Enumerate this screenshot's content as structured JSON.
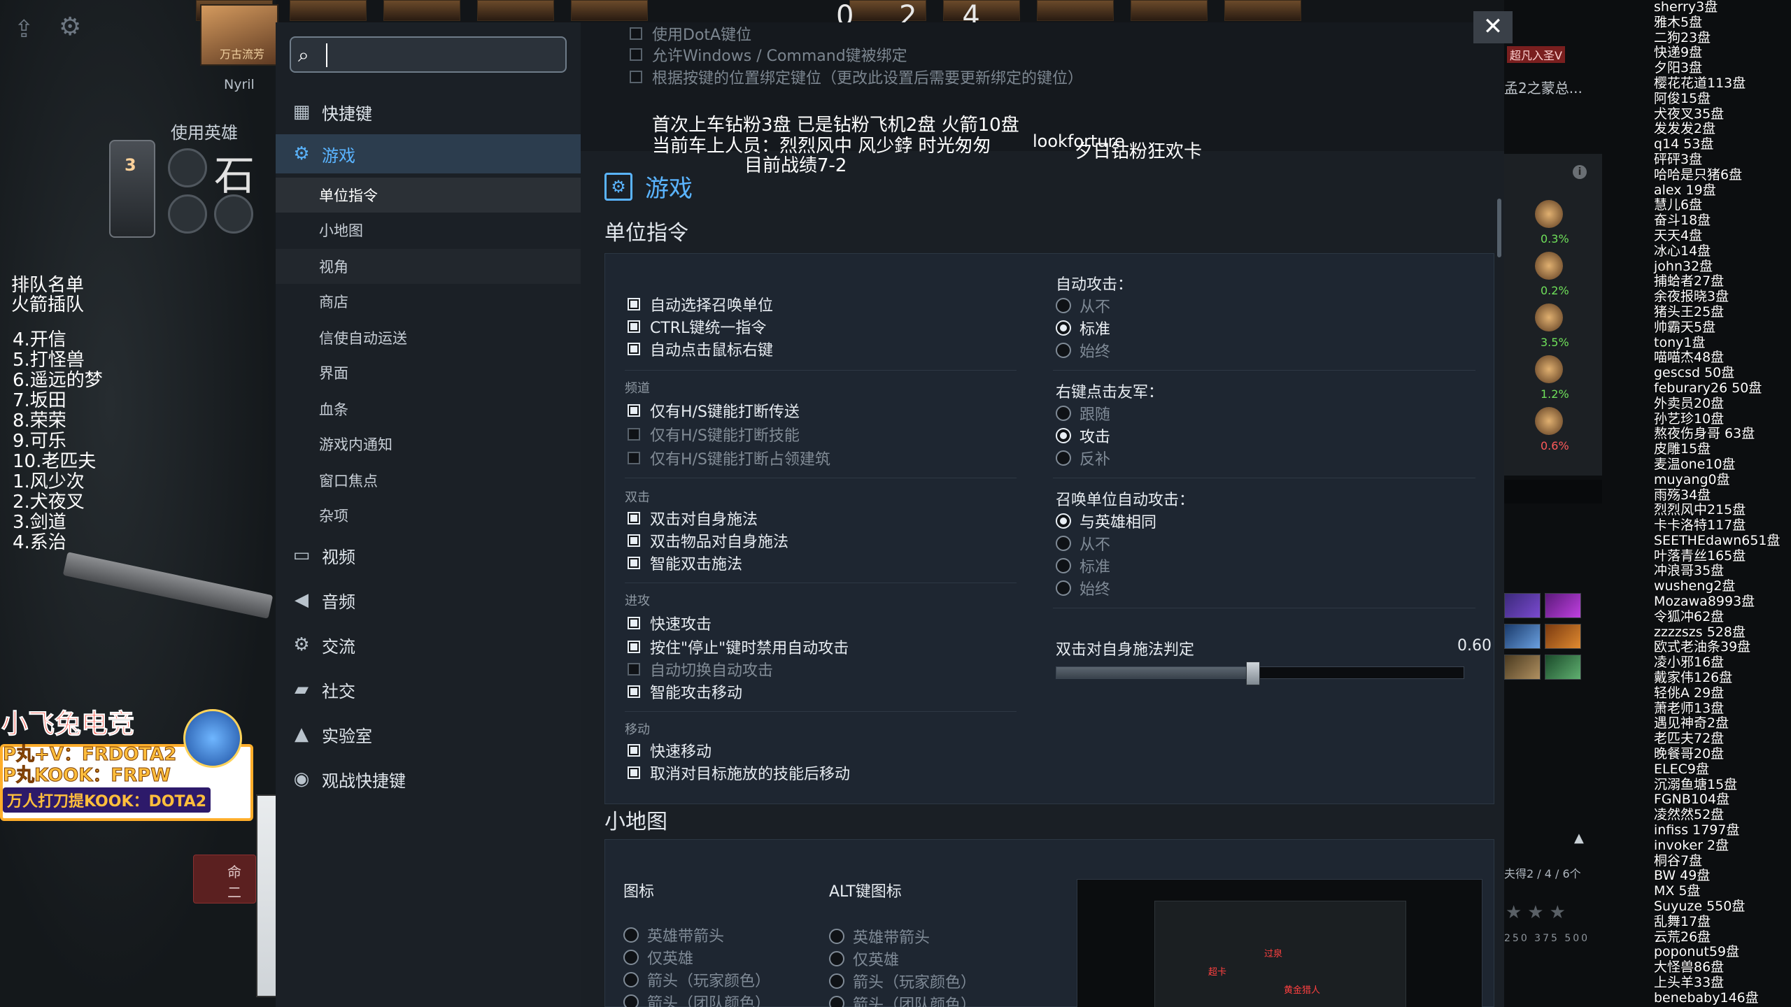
{
  "background": {
    "score_top": "0 2 4",
    "hero_portrait_label": "万古流芳",
    "nyril": "Nyril",
    "use_hero": "使用英雄",
    "rank_num": "3",
    "hero_name_big": "石",
    "queue_title": "排队名单\n火箭插队",
    "queue_list": [
      "4.开信",
      "5.打怪兽",
      "6.遥远的梦",
      "7.坂田",
      "8.荣荣",
      "9.可乐",
      "10.老匹夫",
      "1.风少次",
      "2.犬夜叉",
      "3.剑道",
      "4.系治"
    ],
    "promo": {
      "title": "小飞兔电竞",
      "line1": "P丸+V：FRDOTA2",
      "line2": "P丸KOOK：FRPW",
      "line3": "万人打刀提KOOK：DOTA2"
    },
    "left_tag": "命 二"
  },
  "nav": {
    "search_placeholder": "",
    "items": [
      {
        "label": "快捷键",
        "icon": "grid-icon"
      },
      {
        "label": "游戏",
        "icon": "game-settings-icon"
      },
      {
        "label": "视频",
        "icon": "monitor-icon"
      },
      {
        "label": "音频",
        "icon": "speaker-icon"
      },
      {
        "label": "交流",
        "icon": "gear-icon"
      },
      {
        "label": "社交",
        "icon": "chat-icon"
      },
      {
        "label": "实验室",
        "icon": "flask-icon"
      },
      {
        "label": "观战快捷键",
        "icon": "camera-icon"
      }
    ],
    "sub_items": [
      "单位指令",
      "小地图",
      "视角",
      "商店",
      "信使自动运送",
      "界面",
      "血条",
      "游戏内通知",
      "窗口焦点",
      "杂项"
    ]
  },
  "main": {
    "top_rows": [
      "使用DotA键位",
      "允许Windows / Command键被绑定",
      "根据按键的位置绑定键位（更改此设置后需要更新绑定的键位）"
    ],
    "overlay": {
      "line1": "首次上车钻粉3盘 已是钻粉飞机2盘 火箭10盘",
      "line2": "当前车上人员：烈烈风中  风少鋍  时光匆匆",
      "line2b": "lookforture",
      "line2c": "夕日钻粉狂欢卡",
      "line3": "目前战绩7-2"
    },
    "section_title": "游戏",
    "subsection_unit": "单位指令",
    "subsection_minimap": "小地图",
    "unit_opts": {
      "auto_select_summon": "自动选择召唤单位",
      "ctrl_group": "CTRL键统一指令",
      "auto_right_click": "自动点击鼠标右键",
      "channel_label": "频道",
      "hs_tp": "仅有H/S键能打断传送",
      "hs_skill": "仅有H/S键能打断技能",
      "hs_building": "仅有H/S键能打断占领建筑",
      "double_label": "双击",
      "dbl_self": "双击对自身施法",
      "dbl_item_self": "双击物品对自身施法",
      "smart_dbl": "智能双击施法",
      "attack_label": "进攻",
      "quick_attack": "快速攻击",
      "hold_stop": "按住\"停止\"键时禁用自动攻击",
      "auto_switch": "自动切换自动攻击",
      "smart_attack_move": "智能攻击移动",
      "move_label": "移动",
      "quick_move": "快速移动",
      "cancel_move": "取消对目标施放的技能后移动"
    },
    "auto_attack": {
      "label": "自动攻击：",
      "options": [
        "从不",
        "标准",
        "始终"
      ],
      "selected": 1
    },
    "right_click_ally": {
      "label": "右键点击友军：",
      "options": [
        "跟随",
        "攻击",
        "反补"
      ],
      "selected": 1
    },
    "summon_auto_attack": {
      "label": "召唤单位自动攻击：",
      "options": [
        "与英雄相同",
        "从不",
        "标准",
        "始终"
      ],
      "selected": 0
    },
    "slider": {
      "label": "双击对自身施法判定",
      "value": "0.60",
      "fraction": 0.6
    },
    "minimap": {
      "icons_label": "图标",
      "alt_label": "ALT键图标",
      "icons_options": [
        "英雄带箭头",
        "仅英雄",
        "箭头（玩家颜色）",
        "箭头（团队颜色）"
      ],
      "alt_options": [
        "英雄带箭头",
        "仅英雄",
        "箭头（玩家颜色）",
        "箭头（团队颜色）"
      ],
      "map_labels": [
        "超卡",
        "过泉",
        "黄金猎人"
      ]
    },
    "close_label": "✕"
  },
  "right": {
    "tag_top": "超凡入圣V",
    "king_label": "孟2之蒙总...",
    "percents": [
      "0.3%",
      "0.2%",
      "3.5%",
      "1.2%",
      "0.6%"
    ],
    "info_label": "i",
    "bottom_text": "夫得2 / 4 / 6个",
    "stars": "★★★",
    "nums": "250  375  500"
  },
  "chat": [
    "sherry3盘",
    "雅木5盘",
    "二狗23盘",
    "快递9盘",
    "夕阳3盘",
    "樱花花道113盘",
    "阿俊15盘",
    "犬夜叉35盘",
    "发发发2盘",
    "q14 53盘",
    "砰砰3盘",
    "哈哈是只猪6盘",
    "alex 19盘",
    "慧儿6盘",
    "奋斗18盘",
    "天天4盘",
    "冰心14盘",
    "john32盘",
    "捕蛤者27盘",
    "余夜报晓3盘",
    "猪头王25盘",
    "帅霸天5盘",
    "tony1盘",
    "喵喵杰48盘",
    "gescsd 50盘",
    "feburary26 50盘",
    "外卖员20盘",
    "孙艺珍10盘",
    "熬夜伤身哥 63盘",
    "皮雕15盘",
    "麦温one10盘",
    "muyang0盘",
    "雨殇34盘",
    "烈烈风中215盘",
    "卡卡洛特117盘",
    "SEETHEdawn651盘",
    "叶落青丝165盘",
    "冲浪哥35盘",
    "wusheng2盘",
    "Mozawa8993盘",
    "令狐冲62盘",
    "zzzzszs 528盘",
    "欧式老油条39盘",
    "凌小邪16盘",
    "戴家伟126盘",
    "轻佻A 29盘",
    "萧老师13盘",
    "遇见神奇2盘",
    "老匹夫72盘",
    "晚餐哥20盘",
    "ELEC9盘",
    "沉溺鱼塘15盘",
    "FGNB104盘",
    "凌然然52盘",
    "infiss 1797盘",
    "invoker 2盘",
    "桐谷7盘",
    "BW 49盘",
    "MX 5盘",
    "Suyuze 550盘",
    "乱舞17盘",
    "云荒26盘",
    "poponut59盘",
    "大怪兽86盘",
    "上头羊33盘",
    "benebaby146盘"
  ]
}
